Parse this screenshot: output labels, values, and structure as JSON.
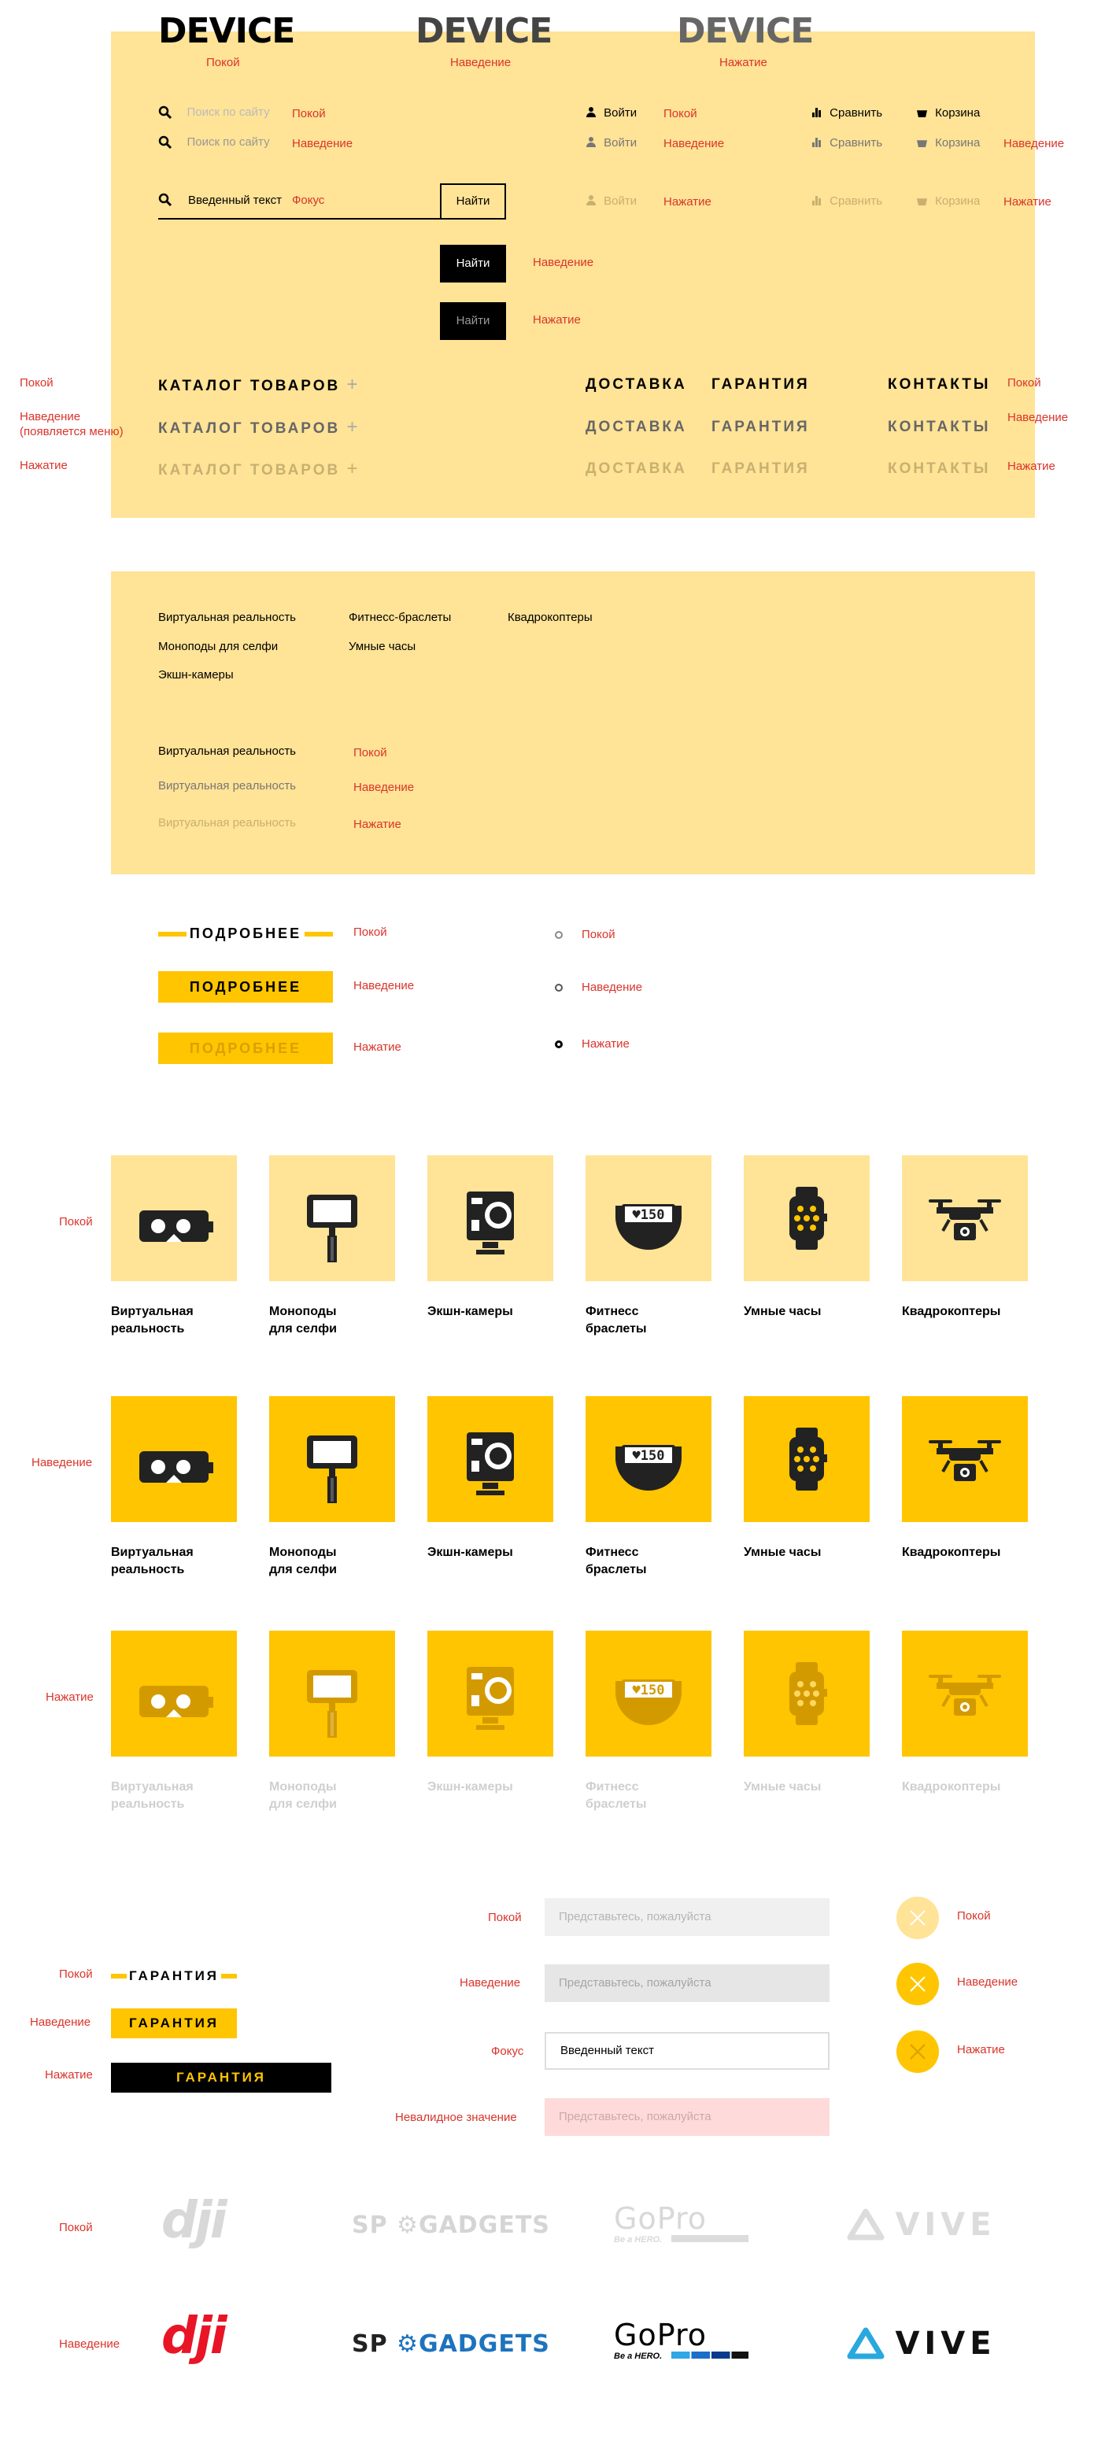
{
  "logo": {
    "text": "DEVICE",
    "states": [
      "Покой",
      "Наведение",
      "Нажатие"
    ]
  },
  "header": {
    "search_placeholder": "Поиск по сайту",
    "search_value": "Введенный текст",
    "search_focus": "Фокус",
    "state_rest": "Покой",
    "state_hover": "Наведение",
    "state_press": "Нажатие",
    "login": "Войти",
    "compare": "Сравнить",
    "cart": "Корзина",
    "find": "Найти"
  },
  "nav": {
    "catalog": "КАТАЛОГ ТОВАРОВ",
    "delivery": "ДОСТАВКА",
    "warranty": "ГАРАНТИЯ",
    "contacts": "КОНТАКТЫ",
    "state_rest": "Покой",
    "state_hover": "Наведение",
    "state_hover_note": "(появляется меню)",
    "state_press": "Нажатие"
  },
  "submenu": {
    "col1": [
      "Виртуальная реальность",
      "Моноподы для селфи",
      "Экшн-камеры"
    ],
    "col2": [
      "Фитнесс-браслеты",
      "Умные часы"
    ],
    "col3": [
      "Квадрокоптеры"
    ],
    "demo": "Виртуальная реальность"
  },
  "more_button": {
    "label": "ПОДРОБНЕЕ"
  },
  "states": {
    "rest": "Покой",
    "hover": "Наведение",
    "press": "Нажатие",
    "focus": "Фокус",
    "invalid": "Невалидное значение"
  },
  "categories": [
    {
      "l1": "Виртуальная",
      "l2": "реальность",
      "icon": "vr-headset-icon"
    },
    {
      "l1": "Моноподы",
      "l2": "для селфи",
      "icon": "selfie-stick-icon"
    },
    {
      "l1": "Экшн-камеры",
      "l2": "",
      "icon": "action-camera-icon"
    },
    {
      "l1": "Фитнесс",
      "l2": "браслеты",
      "icon": "fitness-band-icon"
    },
    {
      "l1": "Умные часы",
      "l2": "",
      "icon": "smartwatch-icon"
    },
    {
      "l1": "Квадрокоптеры",
      "l2": "",
      "icon": "drone-icon"
    }
  ],
  "band_text": "♥150",
  "warranty_button": {
    "label": "ГАРАНТИЯ"
  },
  "form": {
    "placeholder": "Представьтесь, пожалуйста",
    "value": "Введенный текст"
  },
  "brands": {
    "dji": "dji",
    "sp": "SP",
    "gadgets": "GADGETS",
    "gopro": "GoPro",
    "gopro_tag": "Be a HERO.",
    "vive": "VIVE"
  },
  "colors": {
    "panel": "#ffe396",
    "accent": "#ffc500",
    "label_red": "#d9342b",
    "field_bg": "#f0f0f0",
    "invalid_bg": "#ffdada"
  }
}
